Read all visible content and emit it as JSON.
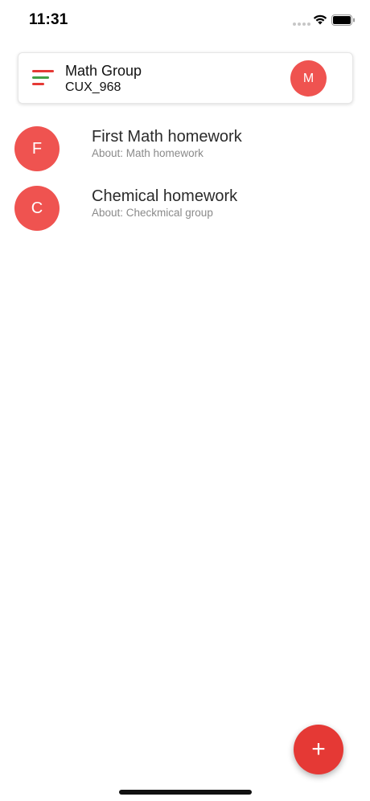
{
  "status_bar": {
    "time": "11:31",
    "icons": [
      "cellular-signal-icon",
      "wifi-icon",
      "battery-icon"
    ]
  },
  "header": {
    "menu_icon": "menu-icon",
    "title": "Math Group",
    "code": "CUX_968",
    "avatar_letter": "M"
  },
  "items": [
    {
      "avatar_letter": "F",
      "title": "First Math homework",
      "subtitle": "About: Math homework"
    },
    {
      "avatar_letter": "C",
      "title": "Chemical homework",
      "subtitle": "About: Checkmical group"
    }
  ],
  "fab": {
    "label": "+",
    "icon": "plus-icon"
  },
  "colors": {
    "accent_red": "#e53935",
    "avatar_red": "#ef5350",
    "menu_green": "#43a047"
  }
}
